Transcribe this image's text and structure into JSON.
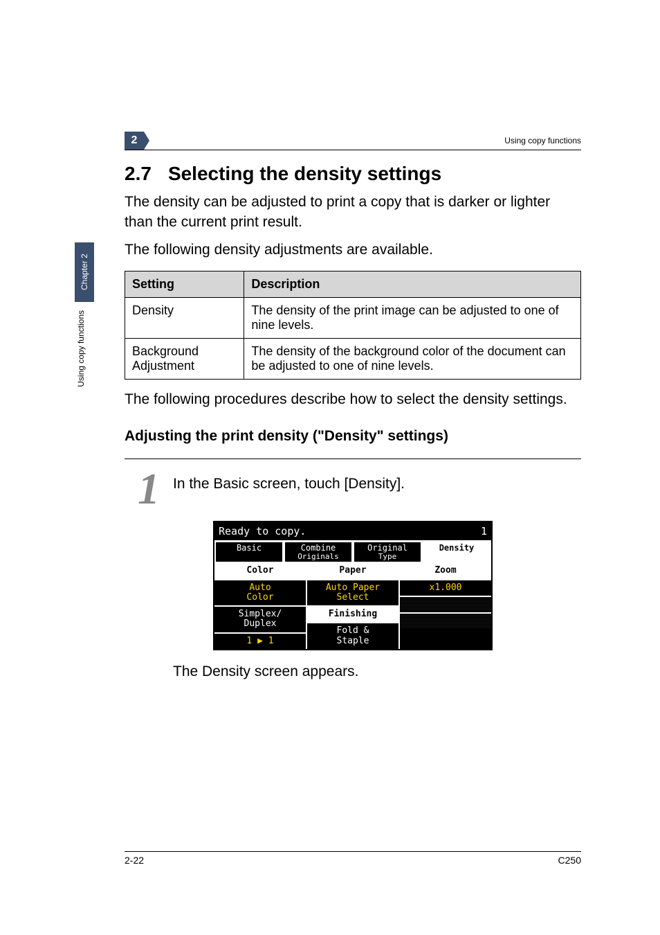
{
  "running_head": {
    "chapter_num": "2",
    "title": "Using copy functions"
  },
  "side": {
    "tab": "Chapter 2",
    "text": "Using copy functions"
  },
  "section": {
    "number": "2.7",
    "title": "Selecting the density settings"
  },
  "intro1": "The density can be adjusted to print a copy that is darker or lighter than the current print result.",
  "intro2": "The following density adjustments are available.",
  "table": {
    "head": {
      "c1": "Setting",
      "c2": "Description"
    },
    "rows": [
      {
        "c1": "Density",
        "c2": "The density of the print image can be adjusted to one of nine levels."
      },
      {
        "c1": "Background Adjustment",
        "c2": "The density of the background color of the document can be adjusted to one of nine levels."
      }
    ]
  },
  "after_table": "The following procedures describe how to select the density settings.",
  "subhead": "Adjusting the print density (\"Density\" settings)",
  "step1": {
    "num": "1",
    "text": "In the Basic screen, touch [Density]."
  },
  "lcd": {
    "status": "Ready to copy.",
    "copies": "1",
    "tabs": {
      "basic": {
        "l1": "Basic"
      },
      "combine": {
        "l1": "Combine",
        "l2": "Originals"
      },
      "original": {
        "l1": "Original",
        "l2": "Type"
      },
      "density": {
        "l1": "Density"
      }
    },
    "grid": {
      "col1": {
        "h": "Color",
        "v": "Auto\nColor",
        "b1": "Simplex/\nDuplex",
        "b2": "1 ▶ 1"
      },
      "col2": {
        "h": "Paper",
        "v": "Auto Paper\nSelect",
        "b1": "Finishing",
        "b2": "Fold &\nStaple"
      },
      "col3": {
        "h": "Zoom",
        "v": "x1.000"
      }
    }
  },
  "after_lcd": "The Density screen appears.",
  "footer": {
    "left": "2-22",
    "right": "C250"
  }
}
